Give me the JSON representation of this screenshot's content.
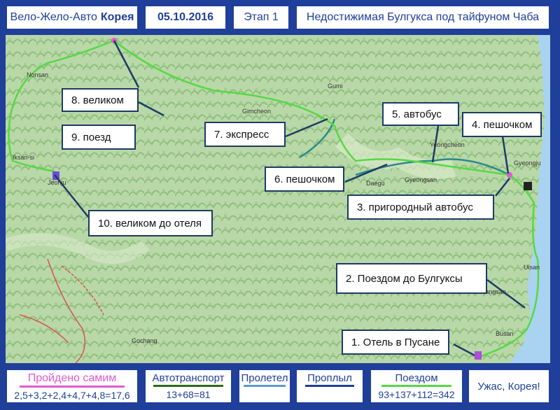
{
  "header": {
    "title_prefix": "Вело-Жело-Авто",
    "title_bold": "Корея",
    "date": "05.10.2016",
    "stage": "Этап 1",
    "subtitle": "Недостижимая Булгукса под тайфуном Чаба"
  },
  "map": {
    "background_color": "#b9d8a8",
    "sea_color": "#a9d3f0",
    "route_color_bike": "#56d944",
    "route_color_transit": "#2a8a8a",
    "town_labels": [
      "Nonsan",
      "Iksan-si",
      "Jeonju",
      "Gimcheon",
      "Gumi",
      "Daegu",
      "Gyeongsan",
      "Yeongcheon",
      "Gyeongju",
      "Ulsan",
      "Yangsan",
      "Busan",
      "Gochang"
    ],
    "callouts": [
      {
        "id": "1",
        "label": "1. Отель в Пусане"
      },
      {
        "id": "2",
        "label": "2. Поездом до Булгуксы"
      },
      {
        "id": "3",
        "label": "3. пригородный автобус"
      },
      {
        "id": "4",
        "label": "4. пешочком"
      },
      {
        "id": "5",
        "label": "5. автобус"
      },
      {
        "id": "6",
        "label": "6. пешочком"
      },
      {
        "id": "7",
        "label": "7. экспресс"
      },
      {
        "id": "8",
        "label": "8. великом"
      },
      {
        "id": "9",
        "label": "9. поезд"
      },
      {
        "id": "10",
        "label": "10. великом до отеля"
      }
    ]
  },
  "legend": {
    "self": {
      "title": "Пройдено самим",
      "value": "2,5+3,2+2,4+4,7+4,8=17,6",
      "color": "#e05ad0"
    },
    "auto": {
      "title": "Автотранспорт",
      "value": "13+68=81",
      "color": "#2e6b1a"
    },
    "flew": {
      "title": "Пролетел",
      "color": "#5b9bd5"
    },
    "swam": {
      "title": "Проплыл",
      "color": "#1f3f9a"
    },
    "train": {
      "title": "Поездом",
      "value": "93+137+112=342",
      "color": "#56d944"
    },
    "remark": "Ужас, Корея!"
  }
}
